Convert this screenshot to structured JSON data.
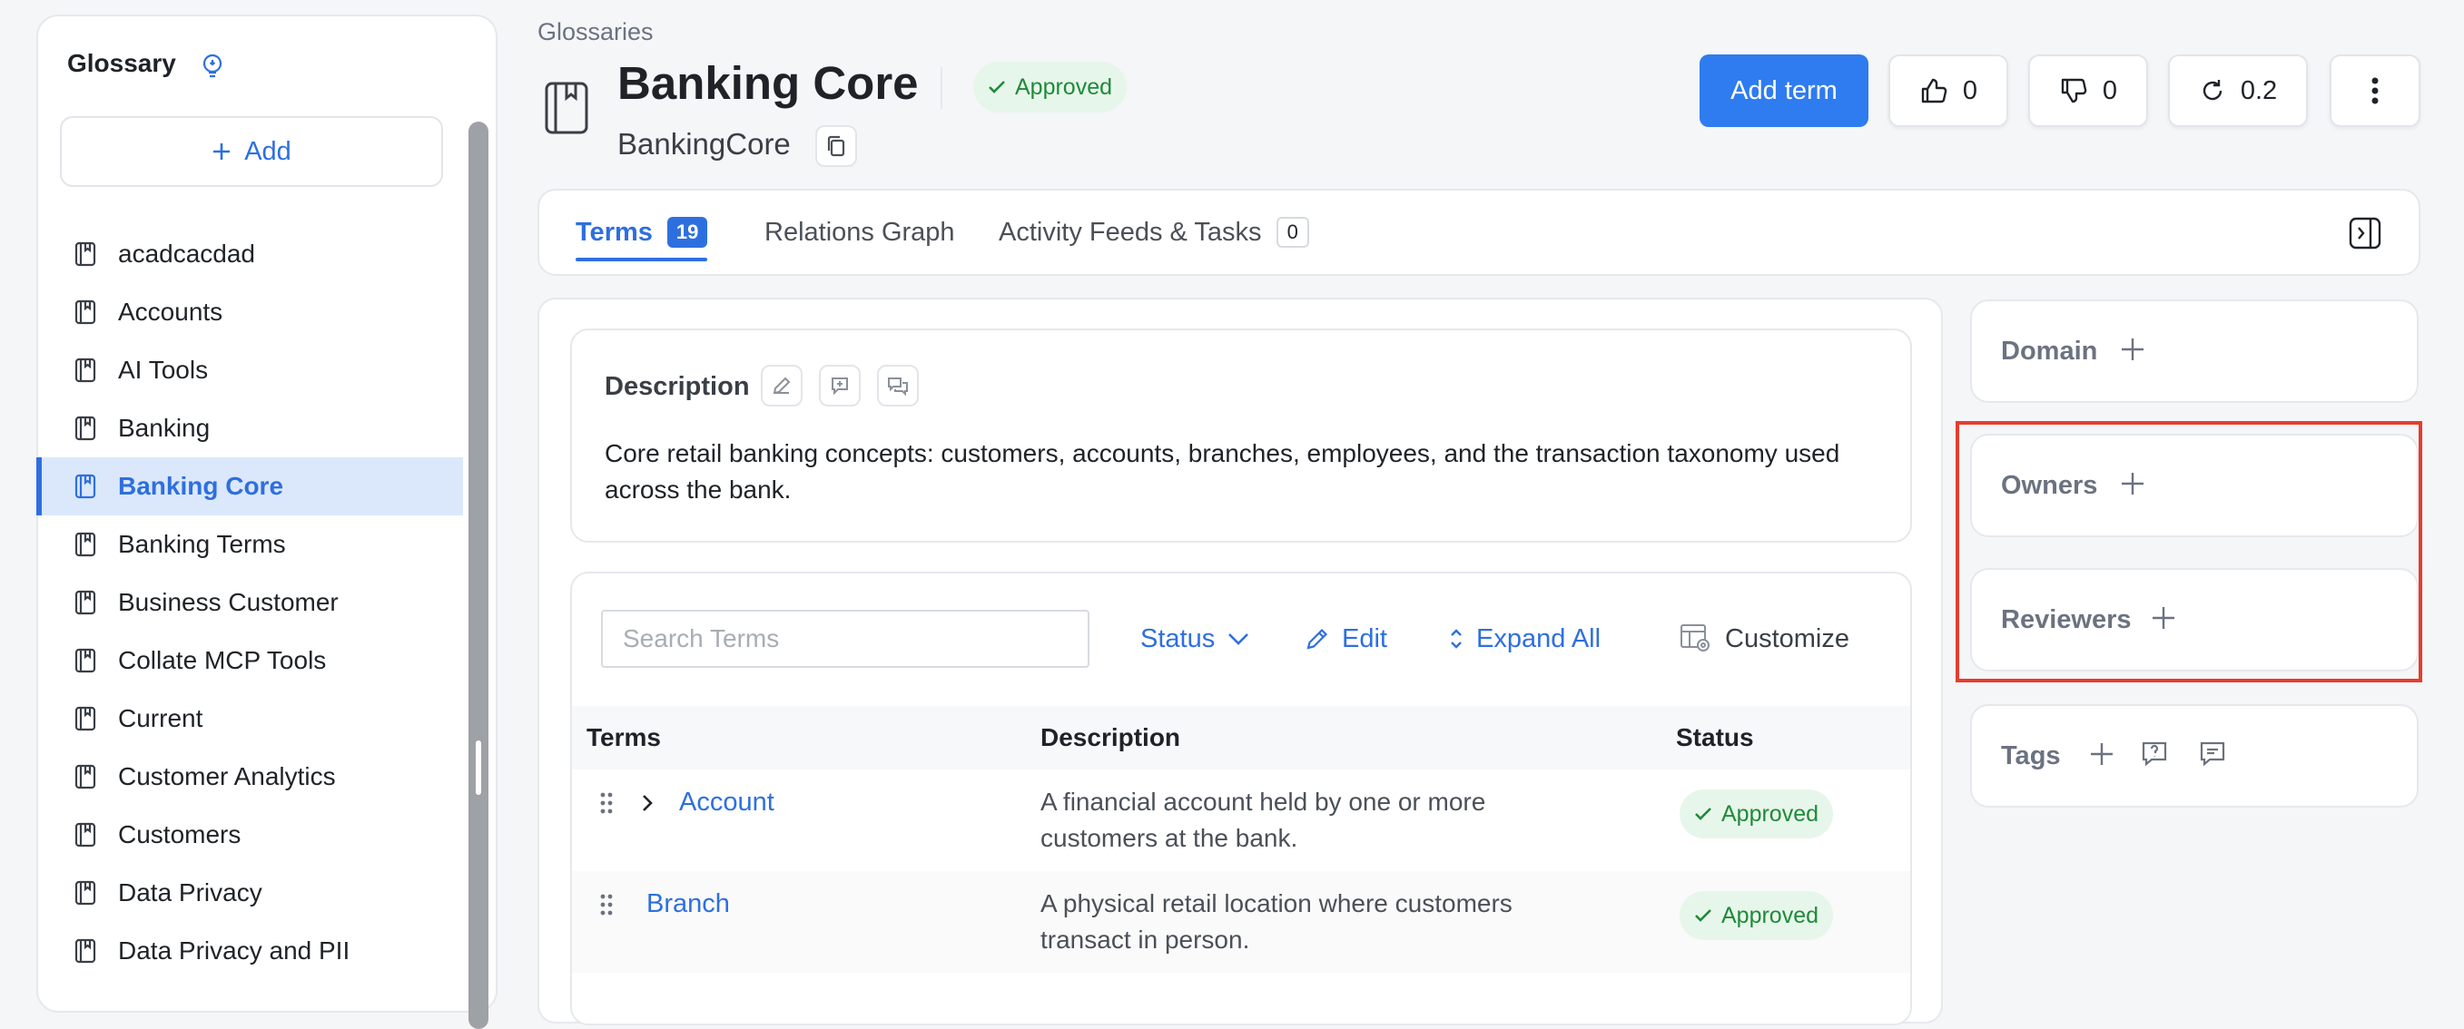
{
  "sidebar": {
    "title": "Glossary",
    "add_label": "Add",
    "items": [
      {
        "label": "acadcacdad",
        "active": false
      },
      {
        "label": "Accounts",
        "active": false
      },
      {
        "label": "AI Tools",
        "active": false
      },
      {
        "label": "Banking",
        "active": false
      },
      {
        "label": "Banking Core",
        "active": true
      },
      {
        "label": "Banking Terms",
        "active": false
      },
      {
        "label": "Business Customer",
        "active": false
      },
      {
        "label": "Collate MCP Tools",
        "active": false
      },
      {
        "label": "Current",
        "active": false
      },
      {
        "label": "Customer Analytics",
        "active": false
      },
      {
        "label": "Customers",
        "active": false
      },
      {
        "label": "Data Privacy",
        "active": false
      },
      {
        "label": "Data Privacy and PII",
        "active": false
      }
    ]
  },
  "header": {
    "breadcrumb": "Glossaries",
    "title": "Banking Core",
    "status": "Approved",
    "fqn": "BankingCore",
    "add_term_label": "Add term",
    "likes": "0",
    "dislikes": "0",
    "version": "0.2"
  },
  "tabs": [
    {
      "label": "Terms",
      "count": "19",
      "active": true
    },
    {
      "label": "Relations Graph",
      "active": false
    },
    {
      "label": "Activity Feeds & Tasks",
      "count": "0",
      "active": false
    }
  ],
  "description": {
    "label": "Description",
    "text": "Core retail banking concepts: customers, accounts, branches, employees, and the transaction taxonomy used across the bank."
  },
  "terms_table": {
    "search_placeholder": "Search Terms",
    "toolbar": {
      "status_label": "Status",
      "edit_label": "Edit",
      "expand_label": "Expand All",
      "customize_label": "Customize"
    },
    "columns": [
      "Terms",
      "Description",
      "Status"
    ],
    "rows": [
      {
        "name": "Account",
        "description": "A financial account held by one or more customers at the bank.",
        "status": "Approved",
        "expandable": true
      },
      {
        "name": "Branch",
        "description": "A physical retail location where customers transact in person.",
        "status": "Approved",
        "expandable": false
      }
    ]
  },
  "right_panel": {
    "domain_label": "Domain",
    "owners_label": "Owners",
    "reviewers_label": "Reviewers",
    "tags_label": "Tags"
  },
  "colors": {
    "accent": "#2e6fe0",
    "primary_button": "#2f7cf0",
    "approved_bg": "#e7f6ea",
    "approved_text": "#1f8a3a",
    "highlight": "#e53d2f"
  }
}
